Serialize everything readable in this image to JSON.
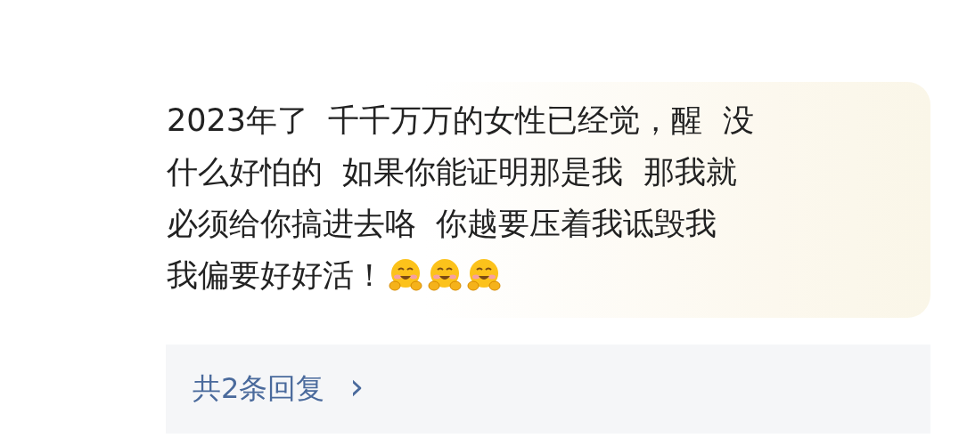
{
  "comment": {
    "lines": [
      "2023年了  千千万万的女性已经觉，醒  没",
      "什么好怕的  如果你能证明那是我  那我就",
      "必须给你搞进去咯  你越要压着我诋毁我",
      "我偏要好好活！"
    ],
    "emojis": [
      {
        "kind": "hug"
      },
      {
        "kind": "hug"
      },
      {
        "kind": "hug"
      }
    ]
  },
  "replies": {
    "label": "共2条回复",
    "arrow": "›"
  }
}
